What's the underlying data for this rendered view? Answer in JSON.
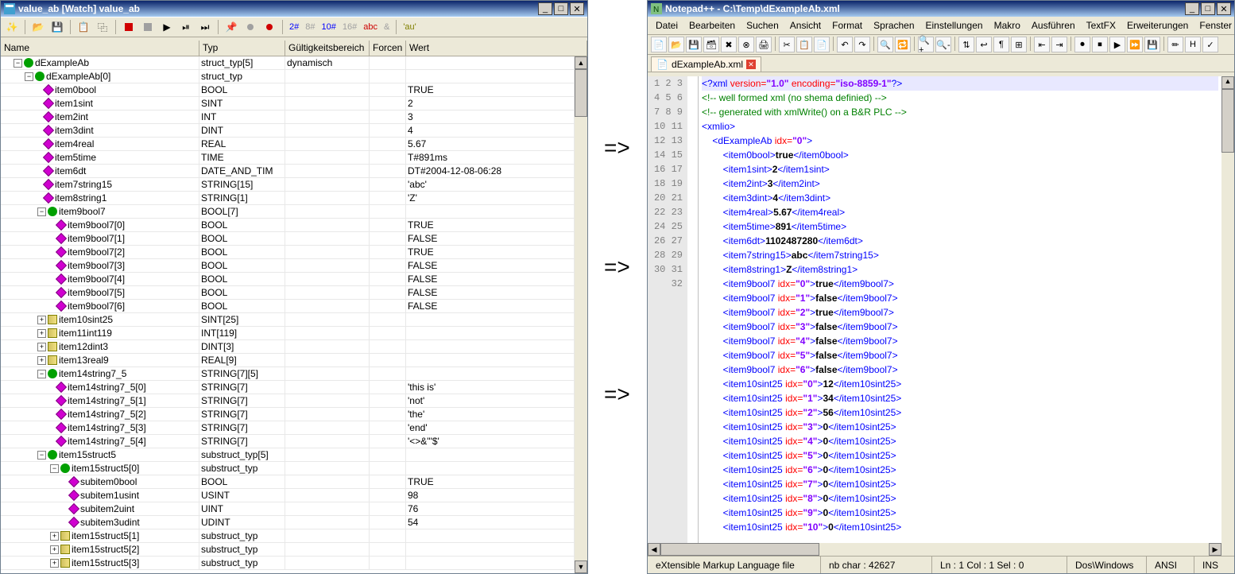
{
  "watch": {
    "title": "value_ab [Watch] value_ab",
    "toolbar_nums": {
      "n2": "2#",
      "n8": "8#",
      "n10": "10#",
      "n16": "16#",
      "abc": "abc",
      "amp": "&",
      "au": "'au'"
    },
    "headers": {
      "name": "Name",
      "typ": "Typ",
      "scope": "Gültigkeitsbereich",
      "force": "Forcen",
      "wert": "Wert"
    },
    "rows": [
      {
        "indent": 14,
        "toggle": "-",
        "icon": "struct",
        "name": "dExampleAb",
        "typ": "struct_typ[5]",
        "scope": "dynamisch",
        "wert": ""
      },
      {
        "indent": 28,
        "toggle": "-",
        "icon": "struct",
        "name": "dExampleAb[0]",
        "typ": "struct_typ",
        "wert": ""
      },
      {
        "indent": 52,
        "icon": "leaf",
        "name": "item0bool",
        "typ": "BOOL",
        "wert": "TRUE"
      },
      {
        "indent": 52,
        "icon": "leaf",
        "name": "item1sint",
        "typ": "SINT",
        "wert": "2"
      },
      {
        "indent": 52,
        "icon": "leaf",
        "name": "item2int",
        "typ": "INT",
        "wert": "3"
      },
      {
        "indent": 52,
        "icon": "leaf",
        "name": "item3dint",
        "typ": "DINT",
        "wert": "4"
      },
      {
        "indent": 52,
        "icon": "leaf",
        "name": "item4real",
        "typ": "REAL",
        "wert": "5.67"
      },
      {
        "indent": 52,
        "icon": "leaf",
        "name": "item5time",
        "typ": "TIME",
        "wert": "T#891ms"
      },
      {
        "indent": 52,
        "icon": "leaf",
        "name": "item6dt",
        "typ": "DATE_AND_TIM",
        "wert": "DT#2004-12-08-06:28"
      },
      {
        "indent": 52,
        "icon": "leaf",
        "name": "item7string15",
        "typ": "STRING[15]",
        "wert": "'abc'"
      },
      {
        "indent": 52,
        "icon": "leaf",
        "name": "item8string1",
        "typ": "STRING[1]",
        "wert": "'Z'"
      },
      {
        "indent": 44,
        "toggle": "-",
        "icon": "struct",
        "name": "item9bool7",
        "typ": "BOOL[7]",
        "wert": ""
      },
      {
        "indent": 68,
        "icon": "leaf",
        "name": "item9bool7[0]",
        "typ": "BOOL",
        "wert": "TRUE"
      },
      {
        "indent": 68,
        "icon": "leaf",
        "name": "item9bool7[1]",
        "typ": "BOOL",
        "wert": "FALSE"
      },
      {
        "indent": 68,
        "icon": "leaf",
        "name": "item9bool7[2]",
        "typ": "BOOL",
        "wert": "TRUE"
      },
      {
        "indent": 68,
        "icon": "leaf",
        "name": "item9bool7[3]",
        "typ": "BOOL",
        "wert": "FALSE"
      },
      {
        "indent": 68,
        "icon": "leaf",
        "name": "item9bool7[4]",
        "typ": "BOOL",
        "wert": "FALSE"
      },
      {
        "indent": 68,
        "icon": "leaf",
        "name": "item9bool7[5]",
        "typ": "BOOL",
        "wert": "FALSE"
      },
      {
        "indent": 68,
        "icon": "leaf",
        "name": "item9bool7[6]",
        "typ": "BOOL",
        "wert": "FALSE"
      },
      {
        "indent": 44,
        "toggle": "+",
        "icon": "closed",
        "name": "item10sint25",
        "typ": "SINT[25]",
        "wert": ""
      },
      {
        "indent": 44,
        "toggle": "+",
        "icon": "closed",
        "name": "item11int119",
        "typ": "INT[119]",
        "wert": ""
      },
      {
        "indent": 44,
        "toggle": "+",
        "icon": "closed",
        "name": "item12dint3",
        "typ": "DINT[3]",
        "wert": ""
      },
      {
        "indent": 44,
        "toggle": "+",
        "icon": "closed",
        "name": "item13real9",
        "typ": "REAL[9]",
        "wert": ""
      },
      {
        "indent": 44,
        "toggle": "-",
        "icon": "struct",
        "name": "item14string7_5",
        "typ": "STRING[7][5]",
        "wert": ""
      },
      {
        "indent": 68,
        "icon": "leaf",
        "name": "item14string7_5[0]",
        "typ": "STRING[7]",
        "wert": "'this is'"
      },
      {
        "indent": 68,
        "icon": "leaf",
        "name": "item14string7_5[1]",
        "typ": "STRING[7]",
        "wert": "'not'"
      },
      {
        "indent": 68,
        "icon": "leaf",
        "name": "item14string7_5[2]",
        "typ": "STRING[7]",
        "wert": "'the'"
      },
      {
        "indent": 68,
        "icon": "leaf",
        "name": "item14string7_5[3]",
        "typ": "STRING[7]",
        "wert": "'end'"
      },
      {
        "indent": 68,
        "icon": "leaf",
        "name": "item14string7_5[4]",
        "typ": "STRING[7]",
        "wert": "'<>&\"'$'"
      },
      {
        "indent": 44,
        "toggle": "-",
        "icon": "struct",
        "name": "item15struct5",
        "typ": "substruct_typ[5]",
        "wert": ""
      },
      {
        "indent": 60,
        "toggle": "-",
        "icon": "struct",
        "name": "item15struct5[0]",
        "typ": "substruct_typ",
        "wert": ""
      },
      {
        "indent": 84,
        "icon": "leaf",
        "name": "subitem0bool",
        "typ": "BOOL",
        "wert": "TRUE"
      },
      {
        "indent": 84,
        "icon": "leaf",
        "name": "subitem1usint",
        "typ": "USINT",
        "wert": "98"
      },
      {
        "indent": 84,
        "icon": "leaf",
        "name": "subitem2uint",
        "typ": "UINT",
        "wert": "76"
      },
      {
        "indent": 84,
        "icon": "leaf",
        "name": "subitem3udint",
        "typ": "UDINT",
        "wert": "54"
      },
      {
        "indent": 60,
        "toggle": "+",
        "icon": "closed",
        "name": "item15struct5[1]",
        "typ": "substruct_typ",
        "wert": ""
      },
      {
        "indent": 60,
        "toggle": "+",
        "icon": "closed",
        "name": "item15struct5[2]",
        "typ": "substruct_typ",
        "wert": ""
      },
      {
        "indent": 60,
        "toggle": "+",
        "icon": "closed",
        "name": "item15struct5[3]",
        "typ": "substruct_typ",
        "wert": ""
      }
    ]
  },
  "arrows": "=>",
  "npp": {
    "title": "Notepad++ - C:\\Temp\\dExampleAb.xml",
    "menus": [
      "Datei",
      "Bearbeiten",
      "Suchen",
      "Ansicht",
      "Format",
      "Sprachen",
      "Einstellungen",
      "Makro",
      "Ausführen",
      "TextFX",
      "Erweiterungen",
      "Fenster",
      "?"
    ],
    "close_x": "X",
    "tab": "dExampleAb.xml",
    "xml_decl": {
      "ver_attr": "version=",
      "ver": "\"1.0\"",
      "enc_attr": "encoding=",
      "enc": "\"iso-8859-1\""
    },
    "comments": [
      "<!-- well formed xml (no shema definied) -->",
      "<!-- generated with xmlWrite() on a B&R PLC -->"
    ],
    "lines": [
      {
        "ln": 4,
        "o": "<",
        "t": "xmlio",
        "c": ">"
      },
      {
        "ln": 5,
        "ind": 4,
        "o": "<",
        "t": "dExampleAb",
        "attr": " idx=",
        "v": "\"0\"",
        "c": ">"
      },
      {
        "ln": 6,
        "ind": 8,
        "tag": "item0bool",
        "txt": "true"
      },
      {
        "ln": 7,
        "ind": 8,
        "tag": "item1sint",
        "txt": "2"
      },
      {
        "ln": 8,
        "ind": 8,
        "tag": "item2int",
        "txt": "3"
      },
      {
        "ln": 9,
        "ind": 8,
        "tag": "item3dint",
        "txt": "4"
      },
      {
        "ln": 10,
        "ind": 8,
        "tag": "item4real",
        "txt": "5.67"
      },
      {
        "ln": 11,
        "ind": 8,
        "tag": "item5time",
        "txt": "891"
      },
      {
        "ln": 12,
        "ind": 8,
        "tag": "item6dt",
        "txt": "1102487280"
      },
      {
        "ln": 13,
        "ind": 8,
        "tag": "item7string15",
        "txt": "abc"
      },
      {
        "ln": 14,
        "ind": 8,
        "tag": "item8string1",
        "txt": "Z"
      },
      {
        "ln": 15,
        "ind": 8,
        "tag": "item9bool7",
        "attr": " idx=",
        "v": "\"0\"",
        "txt": "true"
      },
      {
        "ln": 16,
        "ind": 8,
        "tag": "item9bool7",
        "attr": " idx=",
        "v": "\"1\"",
        "txt": "false"
      },
      {
        "ln": 17,
        "ind": 8,
        "tag": "item9bool7",
        "attr": " idx=",
        "v": "\"2\"",
        "txt": "true"
      },
      {
        "ln": 18,
        "ind": 8,
        "tag": "item9bool7",
        "attr": " idx=",
        "v": "\"3\"",
        "txt": "false"
      },
      {
        "ln": 19,
        "ind": 8,
        "tag": "item9bool7",
        "attr": " idx=",
        "v": "\"4\"",
        "txt": "false"
      },
      {
        "ln": 20,
        "ind": 8,
        "tag": "item9bool7",
        "attr": " idx=",
        "v": "\"5\"",
        "txt": "false"
      },
      {
        "ln": 21,
        "ind": 8,
        "tag": "item9bool7",
        "attr": " idx=",
        "v": "\"6\"",
        "txt": "false"
      },
      {
        "ln": 22,
        "ind": 8,
        "tag": "item10sint25",
        "attr": " idx=",
        "v": "\"0\"",
        "txt": "12"
      },
      {
        "ln": 23,
        "ind": 8,
        "tag": "item10sint25",
        "attr": " idx=",
        "v": "\"1\"",
        "txt": "34"
      },
      {
        "ln": 24,
        "ind": 8,
        "tag": "item10sint25",
        "attr": " idx=",
        "v": "\"2\"",
        "txt": "56"
      },
      {
        "ln": 25,
        "ind": 8,
        "tag": "item10sint25",
        "attr": " idx=",
        "v": "\"3\"",
        "txt": "0"
      },
      {
        "ln": 26,
        "ind": 8,
        "tag": "item10sint25",
        "attr": " idx=",
        "v": "\"4\"",
        "txt": "0"
      },
      {
        "ln": 27,
        "ind": 8,
        "tag": "item10sint25",
        "attr": " idx=",
        "v": "\"5\"",
        "txt": "0"
      },
      {
        "ln": 28,
        "ind": 8,
        "tag": "item10sint25",
        "attr": " idx=",
        "v": "\"6\"",
        "txt": "0"
      },
      {
        "ln": 29,
        "ind": 8,
        "tag": "item10sint25",
        "attr": " idx=",
        "v": "\"7\"",
        "txt": "0"
      },
      {
        "ln": 30,
        "ind": 8,
        "tag": "item10sint25",
        "attr": " idx=",
        "v": "\"8\"",
        "txt": "0"
      },
      {
        "ln": 31,
        "ind": 8,
        "tag": "item10sint25",
        "attr": " idx=",
        "v": "\"9\"",
        "txt": "0"
      },
      {
        "ln": 32,
        "ind": 8,
        "tag": "item10sint25",
        "attr": " idx=",
        "v": "\"10\"",
        "txt": "0"
      }
    ],
    "status": {
      "lang": "eXtensible Markup Language file",
      "chars": "nb char : 42627",
      "pos": "Ln : 1   Col : 1   Sel : 0",
      "eol": "Dos\\Windows",
      "enc": "ANSI",
      "ins": "INS"
    }
  }
}
